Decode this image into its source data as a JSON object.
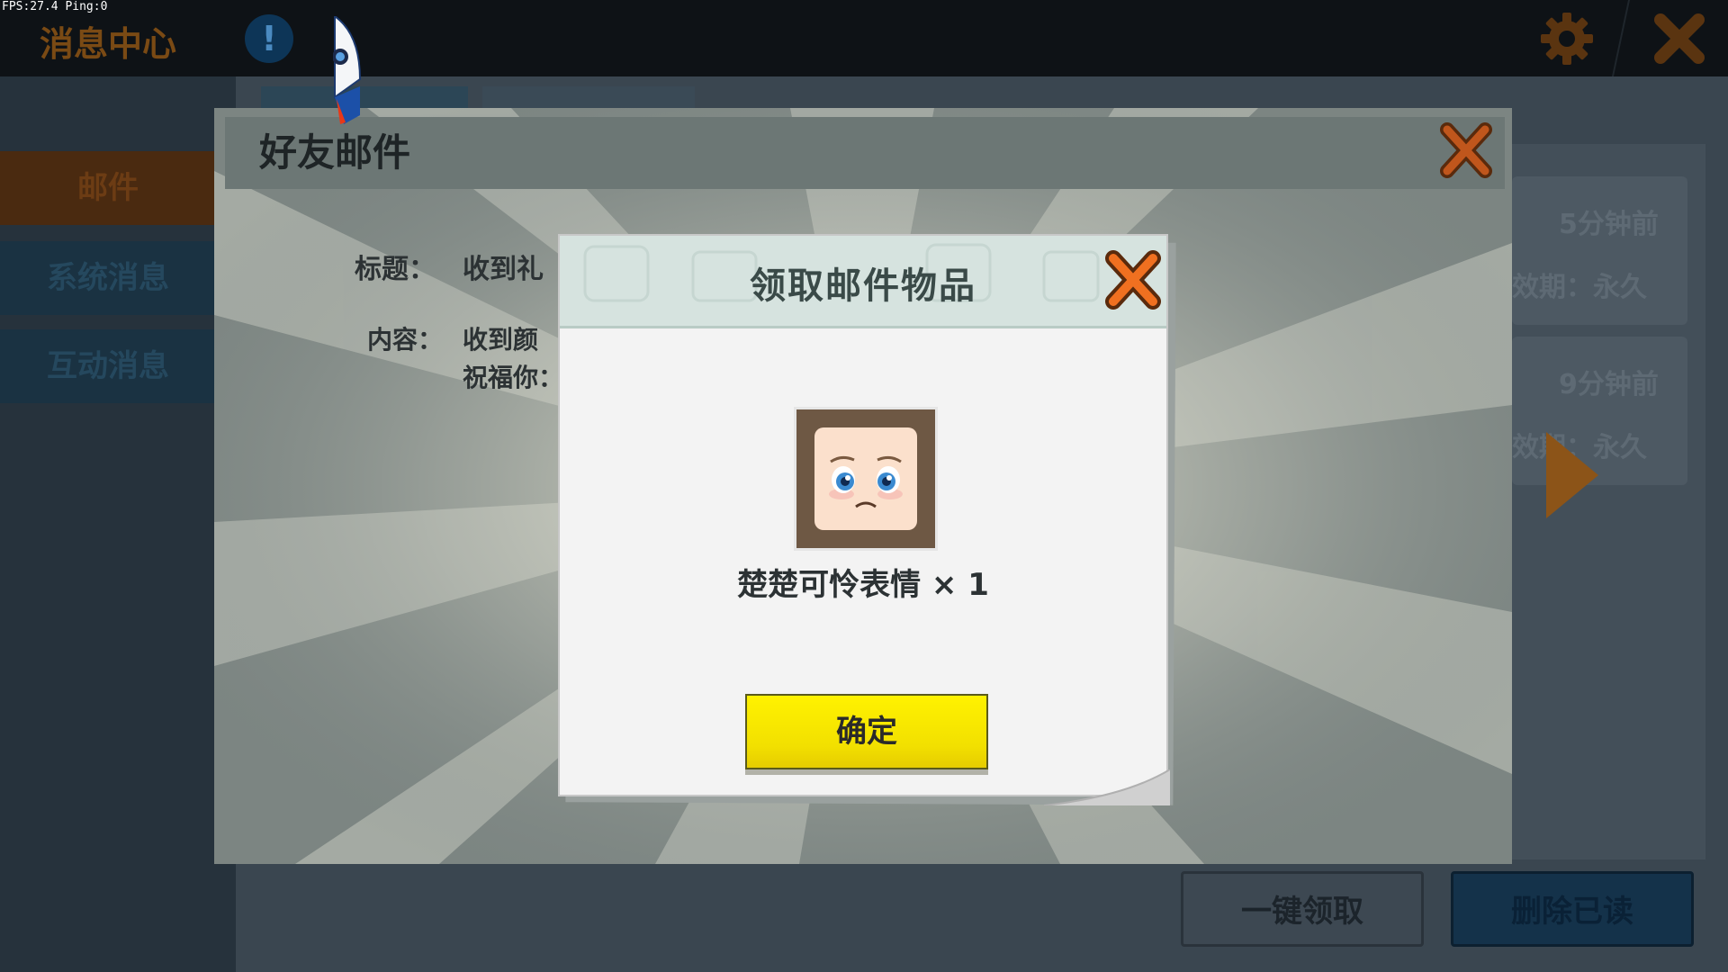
{
  "debug": {
    "fps_text": "FPS:27.4  Ping:0"
  },
  "topbar": {
    "title": "消息中心",
    "info_glyph": "!",
    "icons": [
      "info-icon",
      "gear-icon",
      "close-icon"
    ]
  },
  "sidebar": {
    "items": [
      {
        "label": "邮件",
        "active": true
      },
      {
        "label": "系统消息",
        "active": false
      },
      {
        "label": "互动消息",
        "active": false
      }
    ]
  },
  "mail_list": {
    "cards": [
      {
        "time": "5分钟前",
        "expiry": "有效期：永久"
      },
      {
        "time": "9分钟前",
        "expiry": "有效期：永久"
      }
    ]
  },
  "bottom_actions": {
    "claim_all": "一键领取",
    "delete_read": "删除已读"
  },
  "friend_mail": {
    "title": "好友邮件",
    "subject_label": "标题：",
    "subject_value": "收到礼",
    "content_label": "内容：",
    "content_line1": "收到颜",
    "content_line2": "祝福你："
  },
  "dialog": {
    "title": "领取邮件物品",
    "item_name": "楚楚可怜表情 × 1",
    "confirm_label": "确定"
  },
  "colors": {
    "accent_orange": "#f07020",
    "confirm_yellow": "#fff200",
    "dialog_header": "#d6e3df"
  }
}
